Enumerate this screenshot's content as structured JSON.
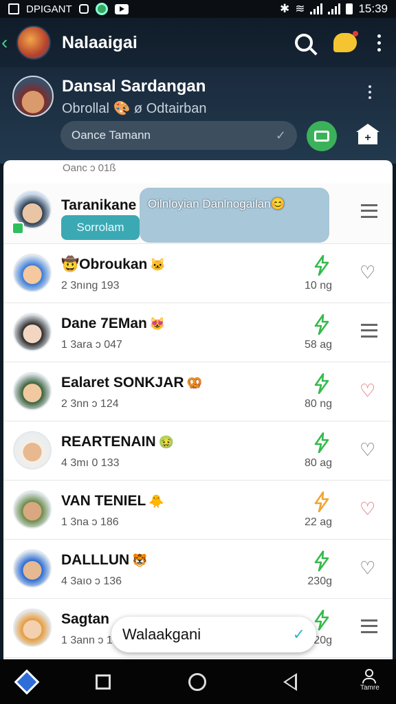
{
  "status_bar": {
    "app_label": "DPIGANT",
    "time": "15:39"
  },
  "app_bar": {
    "title": "Nalaaigai"
  },
  "profile": {
    "name": "Dansal Sardangan",
    "subtitle": "Obrollal 🎨 ø Odtairban",
    "filter_label": "Oance Tamann",
    "filter_check": "✓",
    "add_label": "+"
  },
  "list": {
    "header": "Oanc ɔ 01ß",
    "first": {
      "name": "Taranikane",
      "bubble": "Oilnloyian Danlnogailan😊",
      "tag": "Sorrolam"
    },
    "rows": [
      {
        "name": "Obroukan",
        "emoji_pre": "🤠",
        "emoji": "🐱",
        "sub": "2 3nıng 193",
        "dist": "10 ng",
        "action": "heart",
        "bolt": "green",
        "colors": [
          "#3a7bd5",
          "#f5c8a0"
        ]
      },
      {
        "name": "Dane 7EMan",
        "emoji_pre": "",
        "emoji": "😻",
        "sub": "1 3ara ɔ 047",
        "dist": "58 ag",
        "action": "menu",
        "bolt": "green",
        "colors": [
          "#2b2b2b",
          "#f3d6c2"
        ]
      },
      {
        "name": "Ealaret SONKJAR",
        "emoji_pre": "",
        "emoji": "🥨",
        "sub": "2 3nn ɔ 124",
        "dist": "80 ng",
        "action": "heart-red",
        "bolt": "green",
        "colors": [
          "#3a5f3a",
          "#f0c9a0"
        ]
      },
      {
        "name": "REARTENAIN",
        "emoji_pre": "",
        "emoji": "🤢",
        "sub": "4 3mı 0 133",
        "dist": "80 ag",
        "action": "heart",
        "bolt": "green",
        "colors": [
          "#f5efe6",
          "#e8b890"
        ]
      },
      {
        "name": "VAN TENIEL",
        "emoji_pre": "",
        "emoji": "🐥",
        "sub": "1 3na ɔ 186",
        "dist": "22 ag",
        "action": "heart-red",
        "bolt": "gold",
        "colors": [
          "#6a8a4a",
          "#d9a880"
        ]
      },
      {
        "name": "DALLLUN",
        "emoji_pre": "",
        "emoji": "🐯",
        "sub": "4 3aıo ɔ 136",
        "dist": "230g",
        "action": "heart",
        "bolt": "green",
        "colors": [
          "#2a6ad1",
          "#e5b992"
        ]
      },
      {
        "name": "Sagtan",
        "emoji_pre": "",
        "emoji": "",
        "sub": "1 3ann ɔ 13 1",
        "dist": "20g",
        "action": "menu",
        "bolt": "green",
        "colors": [
          "#e59a3a",
          "#f2d0b0"
        ]
      }
    ]
  },
  "popup": {
    "label": "Walaakgani",
    "chev": "✓"
  },
  "nav": {
    "profile_label": "Tamre"
  },
  "colors": {
    "accent_green": "#36b94d",
    "accent_teal": "#3ba9b4",
    "heart_red": "#e05a5a"
  },
  "icons": [
    "search-icon",
    "chat-icon",
    "more-icon",
    "check-icon",
    "green-action-icon",
    "house-plus-icon",
    "bolt-icon",
    "heart-icon",
    "menu-icon",
    "home-diamond-icon",
    "square-nav-icon",
    "circle-nav-icon",
    "back-nav-icon",
    "person-icon"
  ]
}
